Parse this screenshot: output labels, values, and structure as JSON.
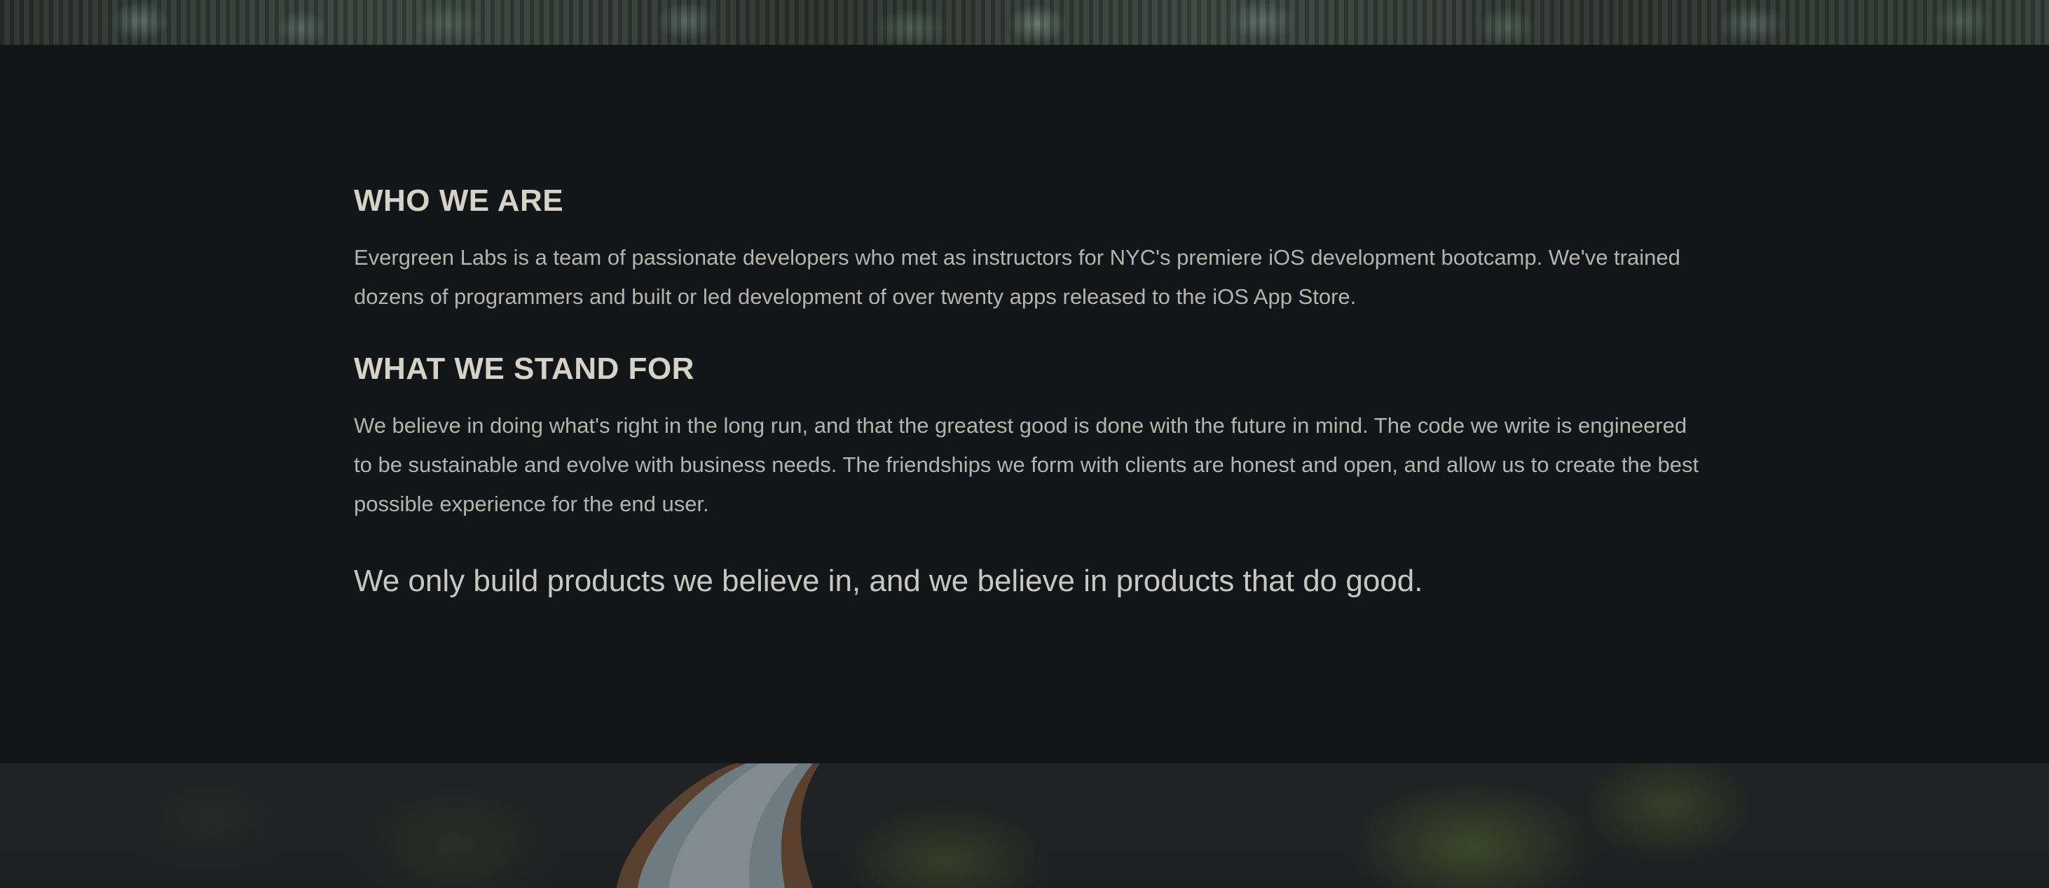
{
  "about": {
    "who_heading": "WHO WE ARE",
    "who_text": "Evergreen Labs is a team of passionate developers who met as instructors for NYC's premiere iOS development bootcamp. We've trained dozens of programmers and built or led development of over twenty apps released to the iOS App Store.",
    "stand_heading": "WHAT WE STAND FOR",
    "stand_text": "We believe in doing what's right in the long run, and that the greatest good is done with the future in mind. The code we write is engineered to be sustainable and evolve with business needs. The friendships we form with clients are honest and open, and allow us to create the best possible experience for the end user.",
    "tagline": "We only build products we believe in, and we believe in products that do good."
  },
  "colors": {
    "panel_background": "#131618",
    "heading": "#d6d2c8",
    "body_text": "#b5b3ad"
  }
}
